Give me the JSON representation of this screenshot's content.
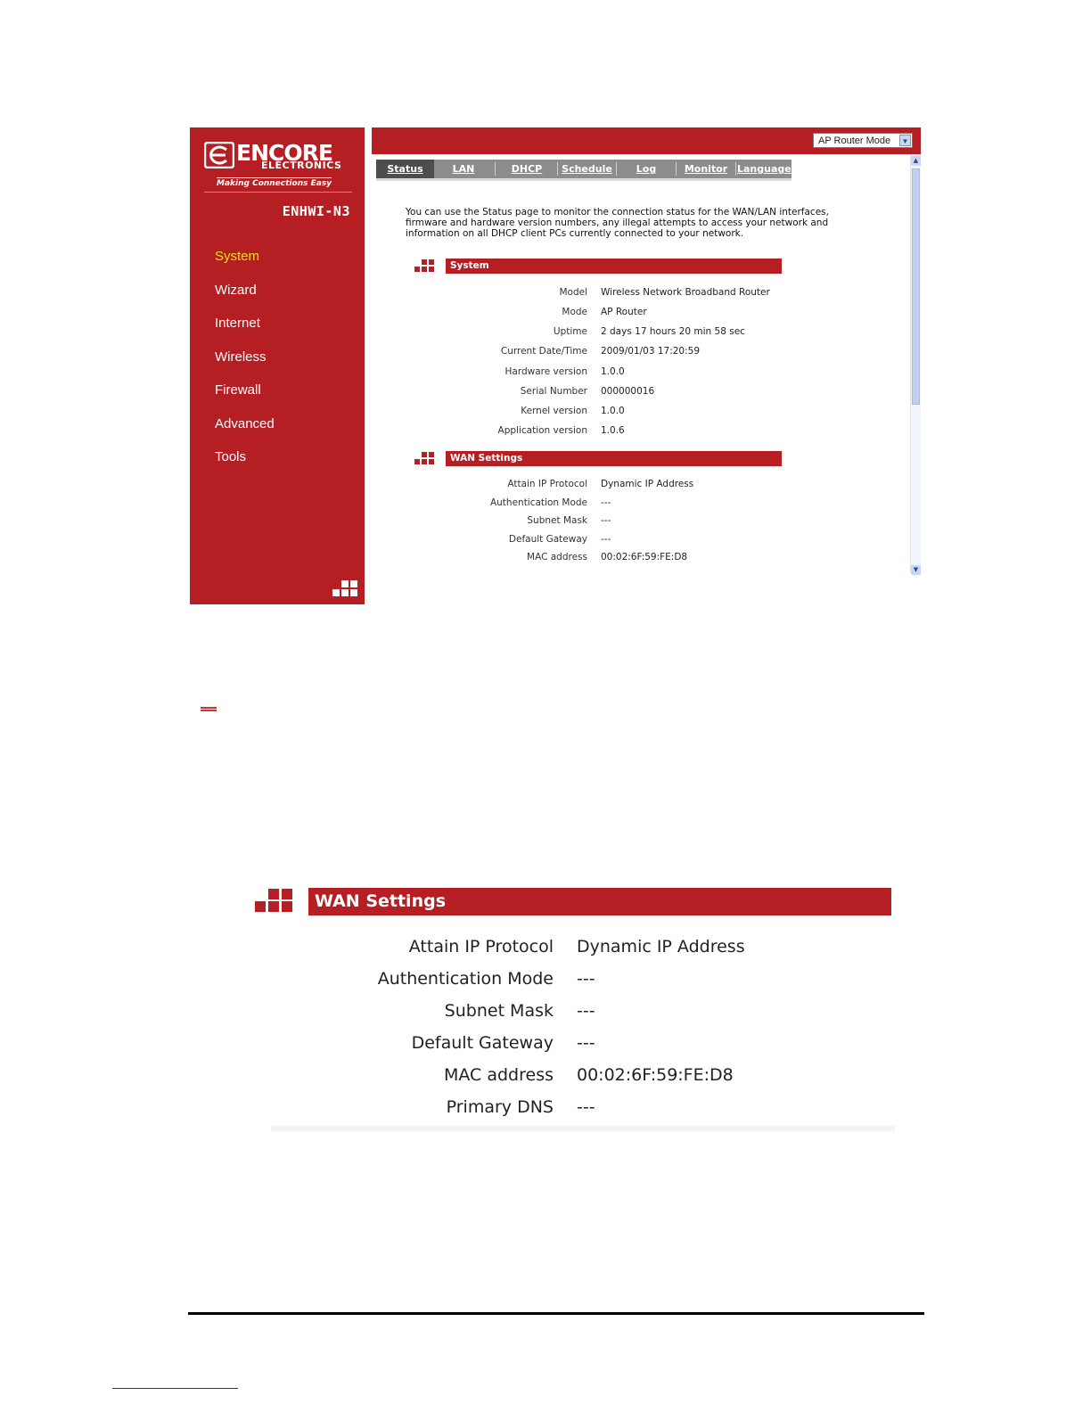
{
  "brand": {
    "name": "ENCORE",
    "sub": "ELECTRONICS",
    "tagline": "Making Connections Easy",
    "model": "ENHWI-N3"
  },
  "sidebar": {
    "items": [
      {
        "label": "System",
        "active": true
      },
      {
        "label": "Wizard"
      },
      {
        "label": "Internet"
      },
      {
        "label": "Wireless"
      },
      {
        "label": "Firewall"
      },
      {
        "label": "Advanced"
      },
      {
        "label": "Tools"
      }
    ]
  },
  "mode_select": {
    "value": "AP Router Mode"
  },
  "tabs": [
    {
      "label": "Status",
      "active": true
    },
    {
      "label": "LAN"
    },
    {
      "label": "DHCP"
    },
    {
      "label": "Schedule"
    },
    {
      "label": "Log"
    },
    {
      "label": "Monitor"
    },
    {
      "label": "Language"
    }
  ],
  "intro": "You can use the Status page to monitor the connection status for the WAN/LAN interfaces, firmware and hardware version numbers, any illegal attempts to access your network and information on all DHCP client PCs currently connected to your network.",
  "system": {
    "title": "System",
    "rows": [
      {
        "label": "Model",
        "value": "Wireless Network Broadband Router"
      },
      {
        "label": "Mode",
        "value": "AP Router"
      },
      {
        "label": "Uptime",
        "value": "2 days 17 hours 20 min 58 sec"
      },
      {
        "label": "Current Date/Time",
        "value": "2009/01/03 17:20:59"
      },
      {
        "label": "Hardware version",
        "value": "1.0.0"
      },
      {
        "label": "Serial Number",
        "value": "000000016"
      },
      {
        "label": "Kernel version",
        "value": "1.0.0"
      },
      {
        "label": "Application version",
        "value": "1.0.6"
      }
    ]
  },
  "wan": {
    "title": "WAN Settings",
    "rows": [
      {
        "label": "Attain IP Protocol",
        "value": "Dynamic IP Address"
      },
      {
        "label": "Authentication Mode",
        "value": "---"
      },
      {
        "label": "Subnet Mask",
        "value": "---"
      },
      {
        "label": "Default Gateway",
        "value": "---"
      },
      {
        "label": "MAC address",
        "value": "00:02:6F:59:FE:D8"
      }
    ]
  },
  "wan_zoom": {
    "title": "WAN Settings",
    "rows": [
      {
        "label": "Attain IP Protocol",
        "value": "Dynamic IP Address"
      },
      {
        "label": "Authentication Mode",
        "value": "---"
      },
      {
        "label": "Subnet Mask",
        "value": "---"
      },
      {
        "label": "Default Gateway",
        "value": "---"
      },
      {
        "label": "MAC address",
        "value": "00:02:6F:59:FE:D8"
      },
      {
        "label": "Primary DNS",
        "value": "---"
      }
    ]
  },
  "colors": {
    "brand_red": "#b51f24",
    "active_nav": "#f6e10f",
    "tab_bar": "#8c8c8c",
    "tab_active": "#4d4d4d"
  }
}
